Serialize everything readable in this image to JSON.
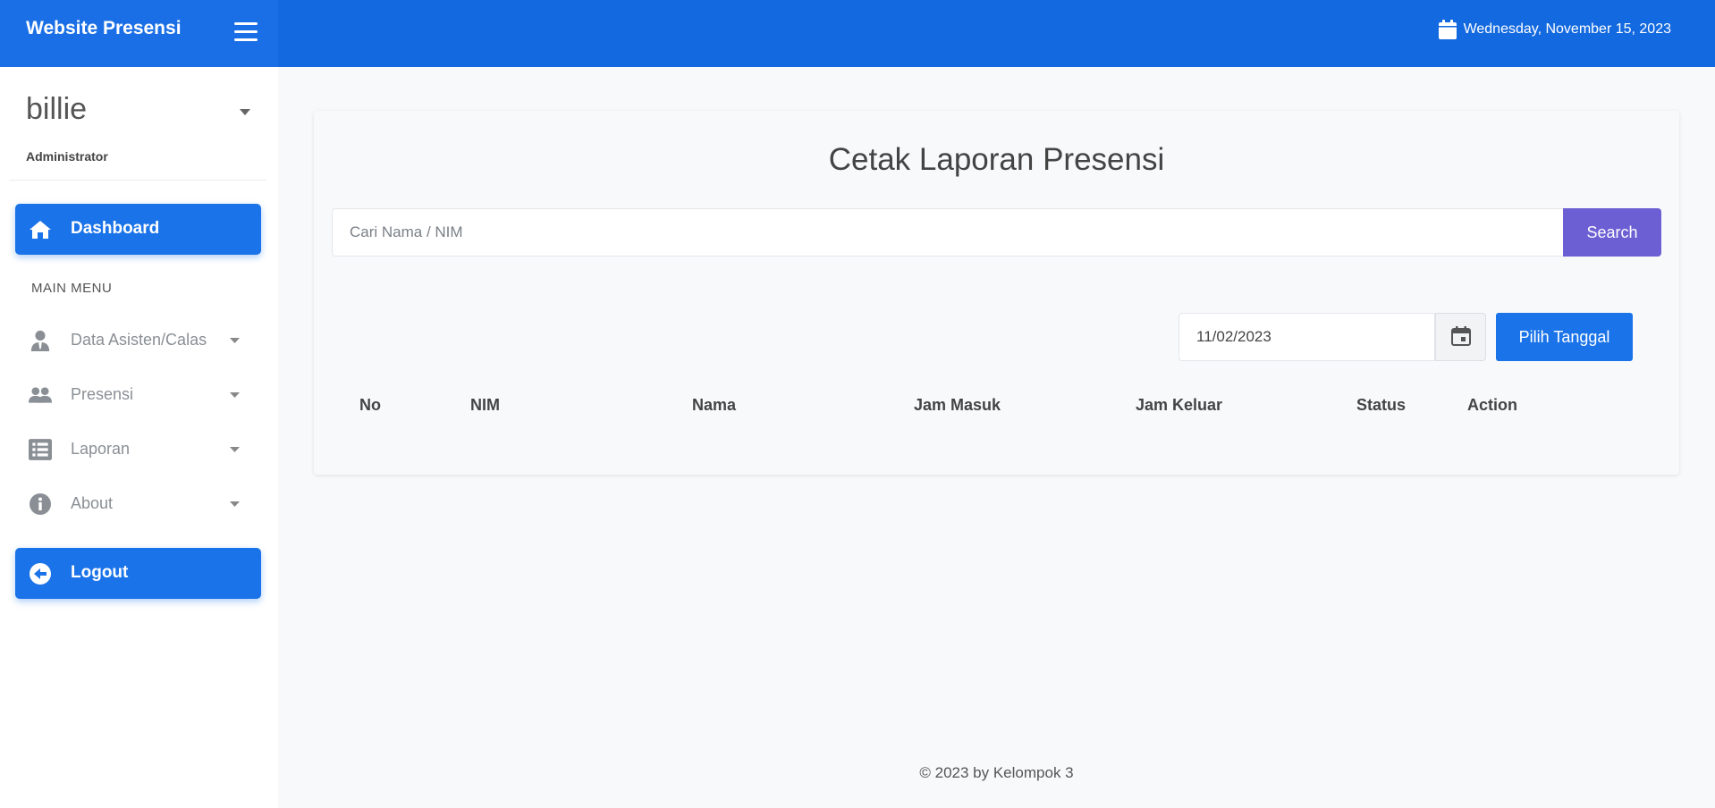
{
  "header": {
    "brand": "Website Presensi",
    "date": "Wednesday, November 15, 2023"
  },
  "sidebar": {
    "user_name": "billie",
    "user_role": "Administrator",
    "dashboard_label": "Dashboard",
    "menu_header": "MAIN MENU",
    "items": [
      {
        "label": "Data Asisten/Calas",
        "icon": "user-tie-icon"
      },
      {
        "label": "Presensi",
        "icon": "users-icon"
      },
      {
        "label": "Laporan",
        "icon": "list-icon"
      },
      {
        "label": "About",
        "icon": "info-icon"
      }
    ],
    "logout_label": "Logout"
  },
  "main": {
    "title": "Cetak Laporan Presensi",
    "search_placeholder": "Cari Nama / NIM",
    "search_button": "Search",
    "date_value": "11/02/2023",
    "pilih_button": "Pilih Tanggal",
    "columns": [
      "No",
      "NIM",
      "Nama",
      "Jam Masuk",
      "Jam Keluar",
      "Status",
      "Action"
    ]
  },
  "footer": {
    "text": "© 2023 by Kelompok 3"
  },
  "colors": {
    "primary": "#1a73e8",
    "topbar": "#1369df",
    "search_button": "#6c5fd3"
  }
}
